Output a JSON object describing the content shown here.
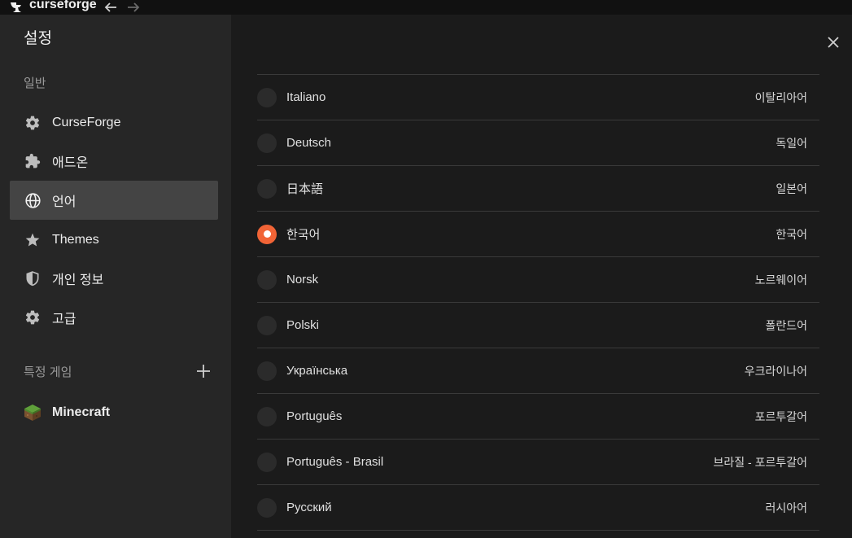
{
  "app": {
    "name": "curseforge"
  },
  "sidebar": {
    "title": "설정",
    "general_label": "일반",
    "items": [
      {
        "label": "CurseForge",
        "icon": "gear-icon"
      },
      {
        "label": "애드온",
        "icon": "puzzle-icon"
      },
      {
        "label": "언어",
        "icon": "globe-icon",
        "active": true
      },
      {
        "label": "Themes",
        "icon": "star-icon"
      },
      {
        "label": "개인 정보",
        "icon": "shield-icon"
      },
      {
        "label": "고급",
        "icon": "gear-icon"
      }
    ],
    "games_label": "특정 게임",
    "games": [
      {
        "label": "Minecraft",
        "icon": "minecraft-grass-block-icon"
      }
    ]
  },
  "languages": [
    {
      "name": "Italiano",
      "native": "이탈리아어",
      "selected": false
    },
    {
      "name": "Deutsch",
      "native": "독일어",
      "selected": false
    },
    {
      "name": "日本語",
      "native": "일본어",
      "selected": false
    },
    {
      "name": "한국어",
      "native": "한국어",
      "selected": true
    },
    {
      "name": "Norsk",
      "native": "노르웨이어",
      "selected": false
    },
    {
      "name": "Polski",
      "native": "폴란드어",
      "selected": false
    },
    {
      "name": "Українська",
      "native": "우크라이나어",
      "selected": false
    },
    {
      "name": "Português",
      "native": "포르투갈어",
      "selected": false
    },
    {
      "name": "Português - Brasil",
      "native": "브라질 - 포르투갈어",
      "selected": false
    },
    {
      "name": "Русский",
      "native": "러시아어",
      "selected": false
    }
  ],
  "colors": {
    "accent": "#f16436",
    "sidebar_bg": "#262626",
    "active_item_bg": "#444444",
    "main_bg": "#1b1b1b"
  }
}
